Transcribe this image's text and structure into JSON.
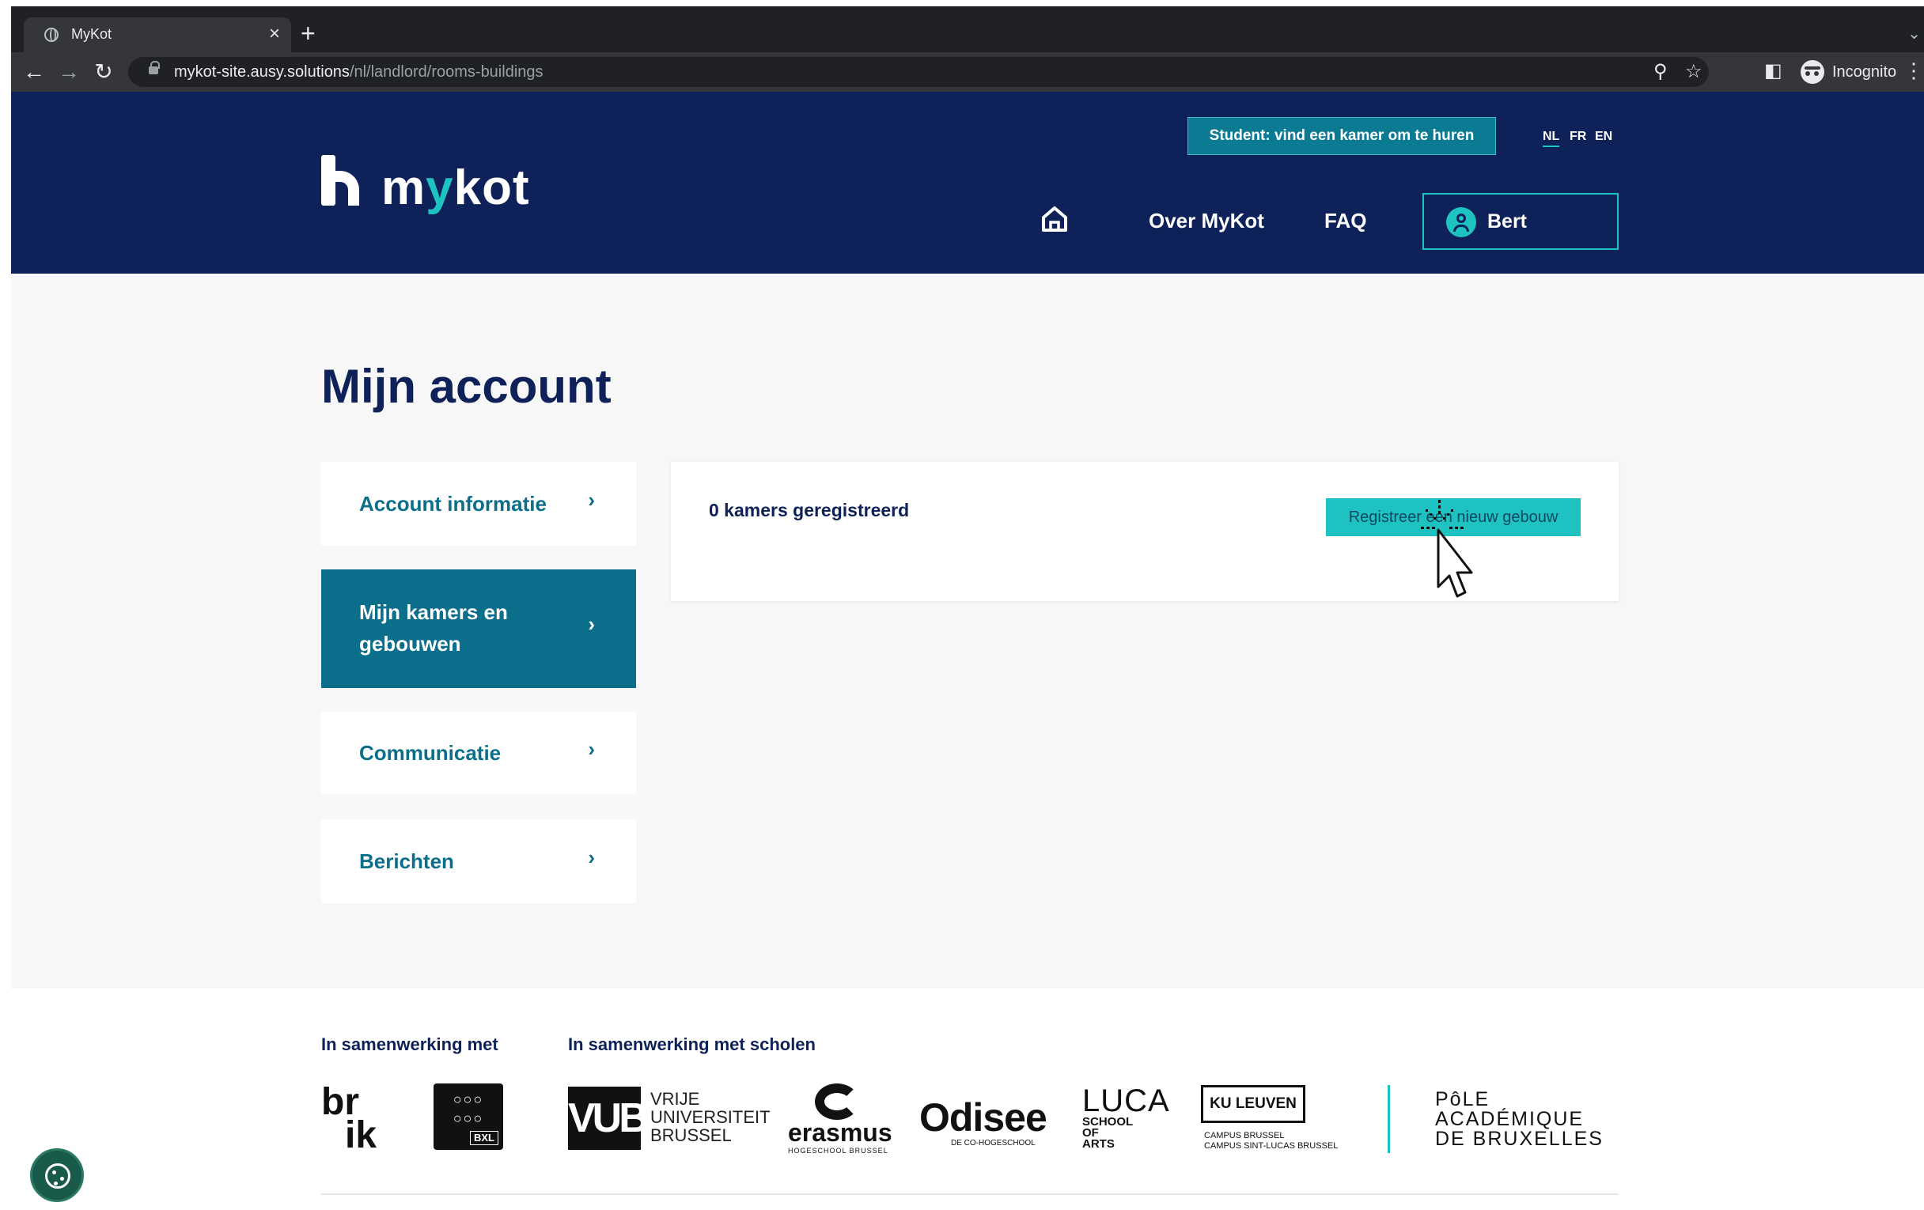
{
  "browser": {
    "tab_title": "MyKot",
    "tab_close": "×",
    "new_tab": "+",
    "url_host": "mykot-site.ausy.solutions",
    "url_path": "/nl/landlord/rooms-buildings",
    "incognito_label": "Incognito"
  },
  "header": {
    "logo_text_before": "m",
    "logo_text_accent": "y",
    "logo_text_after": "kot",
    "student_button": "Student: vind een kamer om te huren",
    "languages": [
      "NL",
      "FR",
      "EN"
    ],
    "active_language": "NL",
    "nav_over": "Over MyKot",
    "nav_faq": "FAQ",
    "user_name": "Bert"
  },
  "main": {
    "title": "Mijn account",
    "sidebar": [
      {
        "label": "Account informatie",
        "active": false
      },
      {
        "label": "Mijn kamers en gebouwen",
        "active": true
      },
      {
        "label": "Communicatie",
        "active": false
      },
      {
        "label": "Berichten",
        "active": false
      }
    ],
    "chevron": "›",
    "rooms_count": "0 kamers geregistreerd",
    "register_button": "Registreer een nieuw gebouw"
  },
  "footer": {
    "partners_heading": "In samenwerking met",
    "schools_heading": "In samenwerking met scholen",
    "logos": {
      "brik": [
        "br",
        "ik"
      ],
      "pole_bxl": "BXL",
      "vub_mark": "VUB",
      "vub_text": [
        "VRIJE",
        "UNIVERSITEIT",
        "BRUSSEL"
      ],
      "erasmus_word": "erasmus",
      "erasmus_sub": "HOGESCHOOL BRUSSEL",
      "odisee_word": "Odisee",
      "odisee_sub": "DE CO-HOGESCHOOL",
      "luca_word": "LUCA",
      "luca_sub": [
        "SCHOOL",
        "OF",
        "ARTS"
      ],
      "kul_box": "KU LEUVEN",
      "kul_sub": [
        "CAMPUS BRUSSEL",
        "CAMPUS SINT-LUCAS BRUSSEL"
      ],
      "pole_acad": [
        "PôLE",
        "ACADÉMIQUE",
        "DE BRUXELLES"
      ]
    }
  },
  "colors": {
    "navy": "#0e2159",
    "teal": "#0b6e8b",
    "accent": "#1ec3c1"
  }
}
